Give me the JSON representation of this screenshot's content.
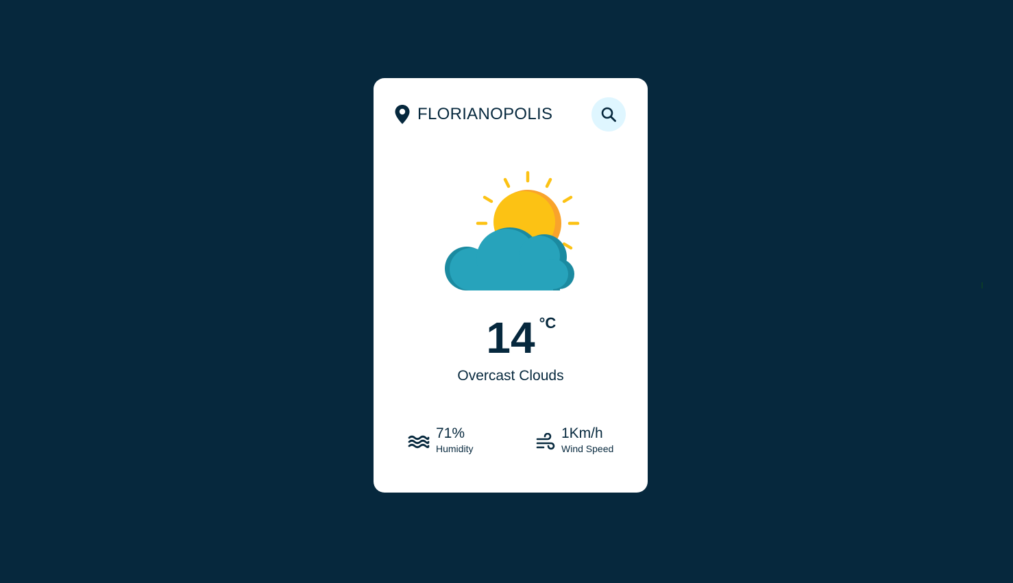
{
  "location": {
    "city": "FLORIANOPOLIS",
    "icon": "location-pin-icon"
  },
  "search": {
    "icon": "search-icon"
  },
  "weather": {
    "icon": "partly-cloudy-icon",
    "temperature": "14",
    "unit": "°C",
    "description": "Overcast Clouds"
  },
  "details": {
    "humidity": {
      "value": "71%",
      "label": "Humidity",
      "icon": "waves-icon"
    },
    "wind": {
      "value": "1Km/h",
      "label": "Wind Speed",
      "icon": "wind-icon"
    }
  },
  "colors": {
    "background": "#06283d",
    "card": "#ffffff",
    "text": "#06283d",
    "search_button": "#dff6ff",
    "sun": "#fcc214",
    "sun_shade": "#f9a32b",
    "cloud": "#27a3bb",
    "cloud_shade": "#1b8aa0"
  }
}
